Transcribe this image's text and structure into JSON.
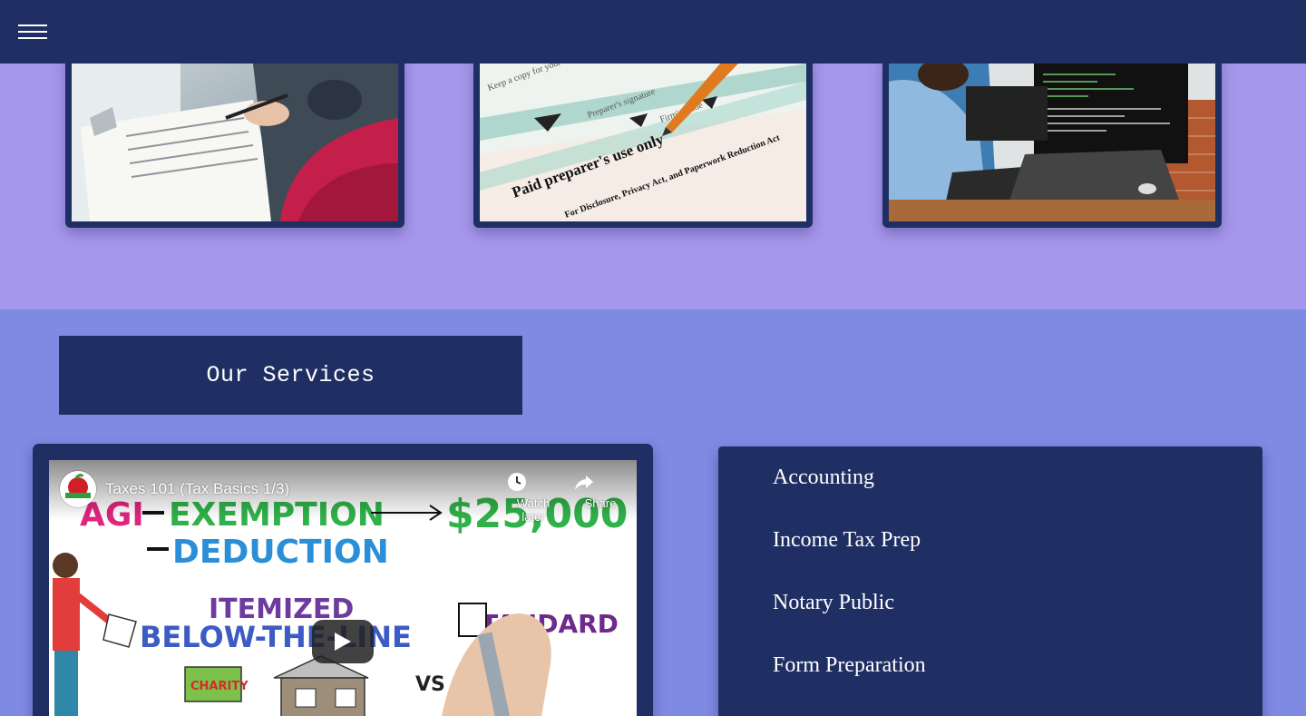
{
  "nav": {
    "menu_icon": "hamburger-menu-icon"
  },
  "gallery": {
    "images": [
      {
        "name": "consultation-photo"
      },
      {
        "name": "tax-form-photo"
      },
      {
        "name": "programmer-photo"
      }
    ],
    "tax_form_text": {
      "paid_preparer": "Paid preparer's use only",
      "disclosure": "For Disclosure, Privacy Act, and Paperwork Reduction Act"
    }
  },
  "services": {
    "title": "Our Services",
    "items": [
      {
        "label": "Accounting"
      },
      {
        "label": "Income Tax Prep"
      },
      {
        "label": "Notary Public"
      },
      {
        "label": "Form Preparation"
      }
    ]
  },
  "video": {
    "title": "Taxes 101 (Tax Basics 1/3)",
    "watch_later_label": "Watch later",
    "share_label": "Share",
    "thumbnail_text": {
      "agi": "AGI",
      "exemption": "EXEMPTION",
      "deduction": "DEDUCTION",
      "amount": "$25,000",
      "itemized": "ITEMIZED",
      "below_the_line": "BELOW-THE-LINE",
      "standard": "STANDARD",
      "vs": "VS",
      "charity": "CHARITY"
    }
  },
  "colors": {
    "nav": "#1f2f63",
    "gallery_bg": "#a597ec",
    "services_bg": "#7f8ae3",
    "card": "#1f2f63"
  }
}
